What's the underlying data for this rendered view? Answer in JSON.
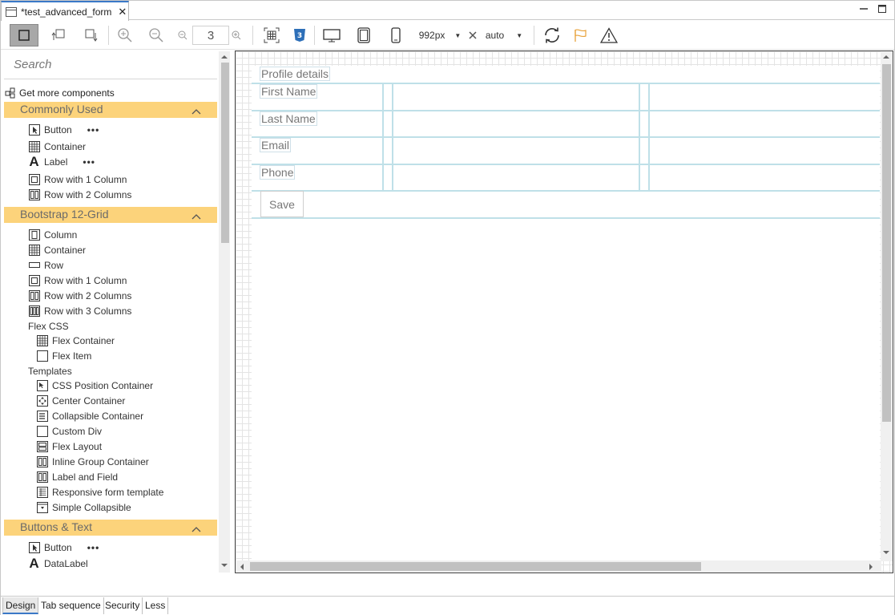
{
  "editor_tab": {
    "title": "*test_advanced_form"
  },
  "toolbar": {
    "zoom_value": "3",
    "width_value": "992px",
    "height_value": "auto"
  },
  "palette": {
    "search_placeholder": "Search",
    "get_more": "Get more components",
    "categories": [
      {
        "label": "Commonly Used"
      },
      {
        "label": "Bootstrap 12-Grid"
      },
      {
        "label": "Buttons & Text"
      }
    ],
    "commonly_used": [
      "Button",
      "Container",
      "Label",
      "Row with 1 Column",
      "Row with 2 Columns"
    ],
    "bootstrap": [
      "Column",
      "Container",
      "Row",
      "Row with 1 Column",
      "Row with 2 Columns",
      "Row with 3 Columns"
    ],
    "flex_group": "Flex CSS",
    "flex": [
      "Flex Container",
      "Flex Item"
    ],
    "templates_group": "Templates",
    "templates": [
      "CSS Position Container",
      "Center Container",
      "Collapsible Container",
      "Custom Div",
      "Flex Layout",
      "Inline Group Container",
      "Label and Field",
      "Responsive form template",
      "Simple Collapsible"
    ],
    "buttons_text": [
      "Button",
      "DataLabel"
    ]
  },
  "form": {
    "title": "Profile details",
    "fields": [
      "First Name",
      "Last Name",
      "Email",
      "Phone"
    ],
    "save_label": "Save"
  },
  "bottom_tabs": [
    "Design",
    "Tab sequence",
    "Security",
    "Less"
  ],
  "colors": {
    "category_bg": "#fcd37b",
    "accent": "#3a78c7",
    "grid_line": "#bfe0e8"
  }
}
